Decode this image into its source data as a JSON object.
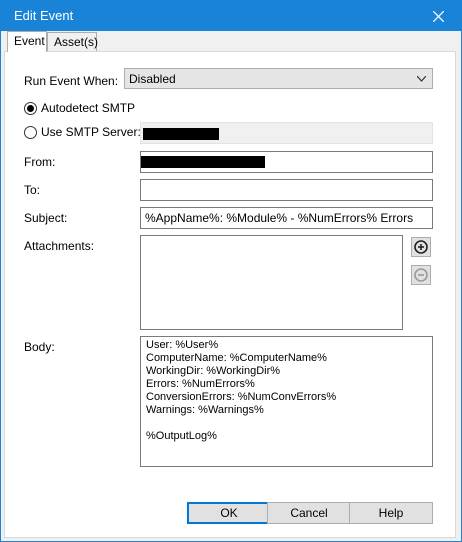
{
  "window": {
    "title": "Edit Event"
  },
  "tabs": [
    {
      "label": "Event",
      "active": true
    },
    {
      "label": "Asset(s)",
      "active": false
    }
  ],
  "form": {
    "run_event_when": {
      "label": "Run Event When:",
      "value": "Disabled"
    },
    "autodetect_smtp": {
      "label": "Autodetect SMTP",
      "checked": true
    },
    "use_smtp_server": {
      "label": "Use SMTP Server:",
      "checked": false,
      "value": "[redacted]"
    },
    "from": {
      "label": "From:",
      "value": "[redacted]"
    },
    "to": {
      "label": "To:",
      "value": ""
    },
    "subject": {
      "label": "Subject:",
      "value": "%AppName%: %Module% - %NumErrors% Errors"
    },
    "attachments": {
      "label": "Attachments:",
      "items": []
    },
    "body": {
      "label": "Body:",
      "lines": [
        "User: %User%",
        "ComputerName: %ComputerName%",
        "WorkingDir: %WorkingDir%",
        "Errors: %NumErrors%",
        "ConversionErrors: %NumConvErrors%",
        "Warnings: %Warnings%",
        "",
        "%OutputLog%"
      ]
    }
  },
  "buttons": {
    "ok": "OK",
    "cancel": "Cancel",
    "help": "Help"
  },
  "icons": {
    "add": "plus-circle-icon",
    "remove": "minus-circle-icon",
    "close": "close-icon",
    "dropdown": "chevron-down-icon"
  },
  "colors": {
    "titlebar": "#1883d7",
    "default_button_border": "#0078d7"
  }
}
